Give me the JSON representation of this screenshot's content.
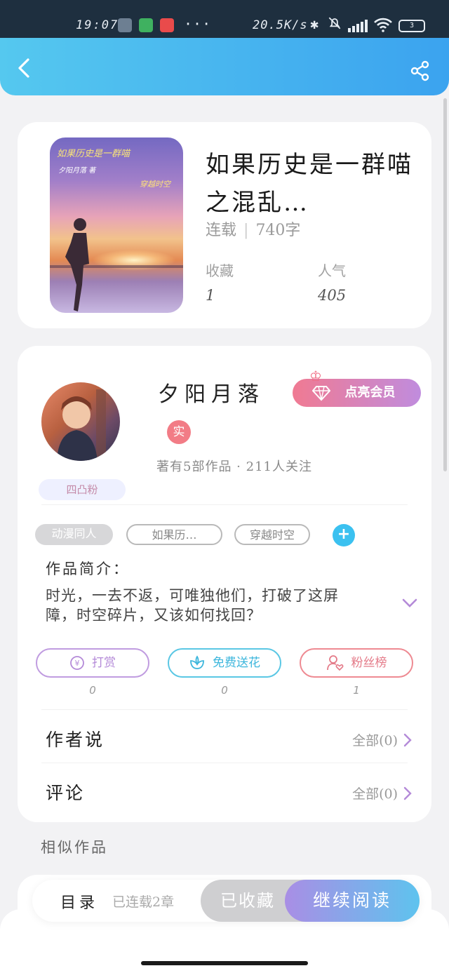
{
  "status_bar": {
    "time": "19:07",
    "more": "···",
    "speed": "20.5K/s",
    "battery": "3"
  },
  "book": {
    "title": "如果历史是一群喵之混乱…",
    "status": "连载",
    "word_count": "740字",
    "cover": {
      "title": "如果历史是一群喵",
      "author": "夕阳月落 著",
      "tag": "穿越时空"
    },
    "stats": [
      {
        "label": "收藏",
        "value": "1"
      },
      {
        "label": "人气",
        "value": "405"
      }
    ]
  },
  "author": {
    "name": "夕阳月落",
    "vip_button": "点亮会员",
    "real_badge": "实",
    "fan_badge": "四凸粉",
    "stats": "著有5部作品 · 211人关注"
  },
  "tags": [
    "动漫同人",
    "如果历…",
    "穿越时空"
  ],
  "intro": {
    "label": "作品简介：",
    "text": "时光，一去不返，可唯独他们，打破了这屏障，时空碎片，又该如何找回？"
  },
  "actions": [
    {
      "label": "打赏",
      "count": "0",
      "icon": "yen-icon",
      "color": "#b48ad8"
    },
    {
      "label": "免费送花",
      "count": "0",
      "icon": "flower-icon",
      "color": "#3cb6dc"
    },
    {
      "label": "粉丝榜",
      "count": "1",
      "icon": "fan-ranking-icon",
      "color": "#e47a88"
    }
  ],
  "rows": [
    {
      "label": "作者说",
      "meta": "全部(0)"
    },
    {
      "label": "评论",
      "meta": "全部(0)"
    }
  ],
  "similar_label": "相似作品",
  "bottom_bar": {
    "toc": "目录",
    "serial": "已连载2章",
    "collected": "已收藏",
    "read": "继续阅读"
  },
  "colors": {
    "header_start": "#55c8ef",
    "header_end": "#3ba3ef",
    "accent_pink": "#f07a92",
    "accent_purple": "#c08cde"
  }
}
